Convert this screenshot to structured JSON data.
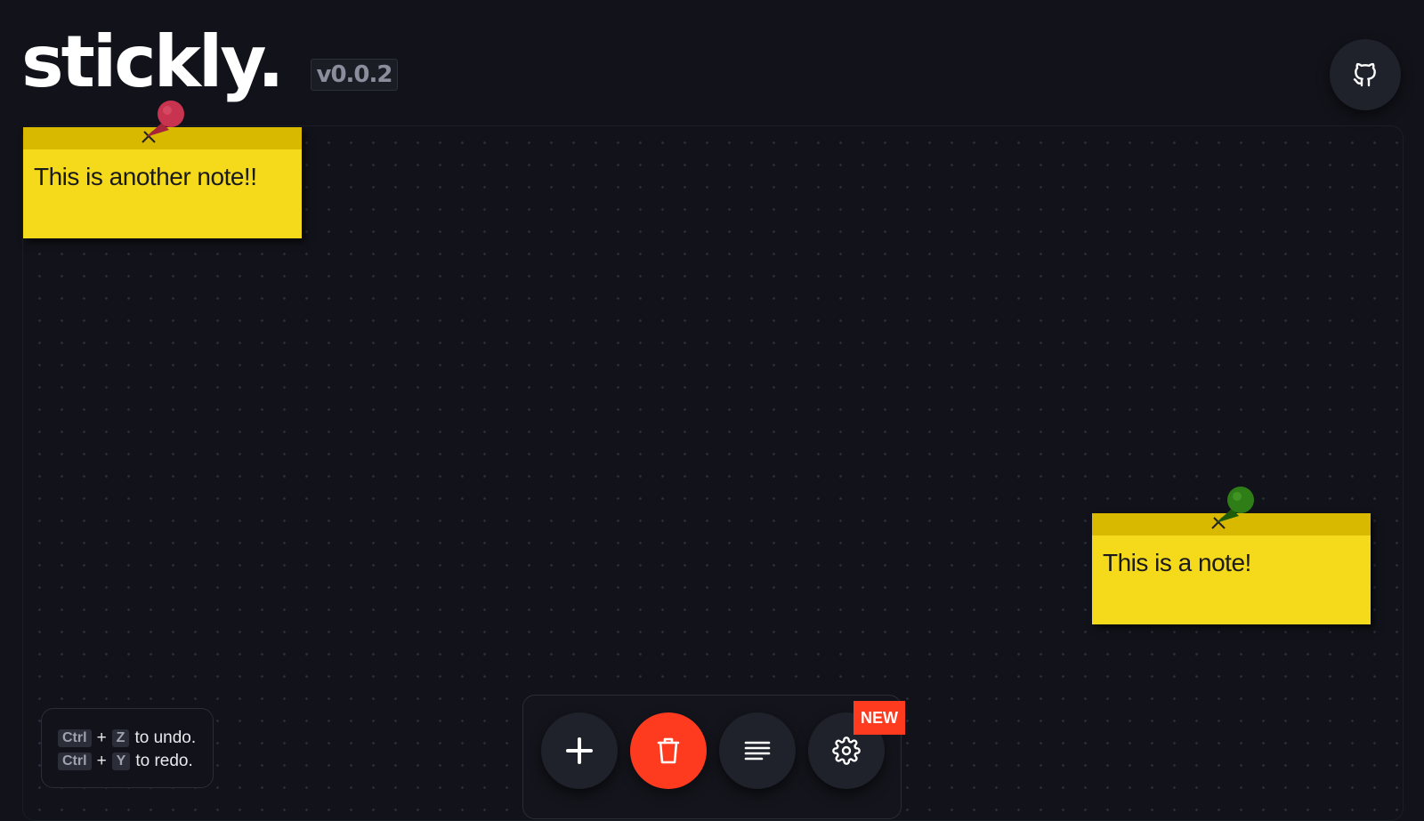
{
  "header": {
    "logo": "stickly.",
    "version": "v0.0.2",
    "github_icon": "github-icon"
  },
  "notes": [
    {
      "text": "This is another note!!",
      "pin_color": "#c8344f"
    },
    {
      "text": "This is a note!",
      "pin_color": "#2e7d16"
    }
  ],
  "note_colors": {
    "body": "#f5da1b",
    "bar": "#d9b900"
  },
  "shortcuts": {
    "undo": {
      "mod": "Ctrl",
      "plus": "+",
      "key": "Z",
      "label": "to undo."
    },
    "redo": {
      "mod": "Ctrl",
      "plus": "+",
      "key": "Y",
      "label": "to redo."
    }
  },
  "toolbar": {
    "add_icon": "plus-icon",
    "delete_icon": "trash-icon",
    "list_icon": "align-lines-icon",
    "settings_icon": "gear-icon",
    "new_badge": "NEW",
    "accent": "#ff3b1f"
  }
}
